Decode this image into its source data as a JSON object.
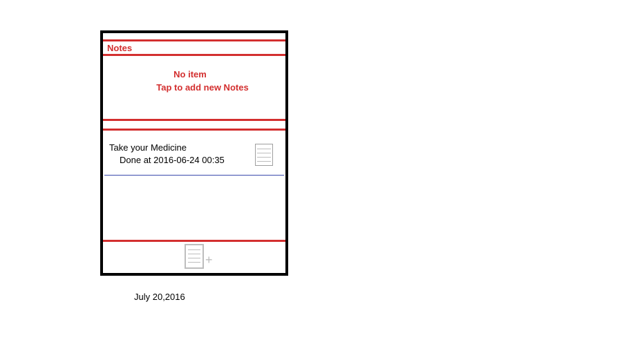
{
  "header": {
    "title": "Notes"
  },
  "empty_state": {
    "line1": "No item",
    "line2": "Tap to add new Notes"
  },
  "list": {
    "items": [
      {
        "title": "Take your Medicine",
        "status": "Done at 2016-06-24 00:35",
        "icon": "note-icon"
      }
    ]
  },
  "footer": {
    "add_icon": "add-note-icon",
    "plus_glyph": "+"
  },
  "caption": {
    "date": "July 20,2016"
  },
  "colors": {
    "accent": "#d32f2f",
    "frame": "#000000",
    "divider": "#3949ab",
    "icon": "#bdbdbd"
  }
}
